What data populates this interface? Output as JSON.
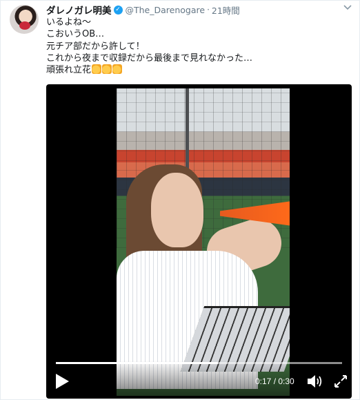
{
  "tweet": {
    "display_name": "ダレノガレ明美",
    "handle": "@The_Darenogare",
    "separator": "·",
    "time": "21時間",
    "lines": [
      "いるよね～",
      "こおいうOB…",
      "元チア部だから許して！",
      "これから夜まで収録だから最後まで見れなかった…",
      "頑張れ立花"
    ],
    "emoji": [
      "clapping-hands",
      "clapping-hands",
      "clapping-hands"
    ]
  },
  "video": {
    "current_time": "0:17",
    "duration": "0:30",
    "time_separator": " / ",
    "progress": 0.5667
  },
  "colors": {
    "verified": "#1da1f2",
    "text": "#14171a",
    "muted": "#657786"
  }
}
